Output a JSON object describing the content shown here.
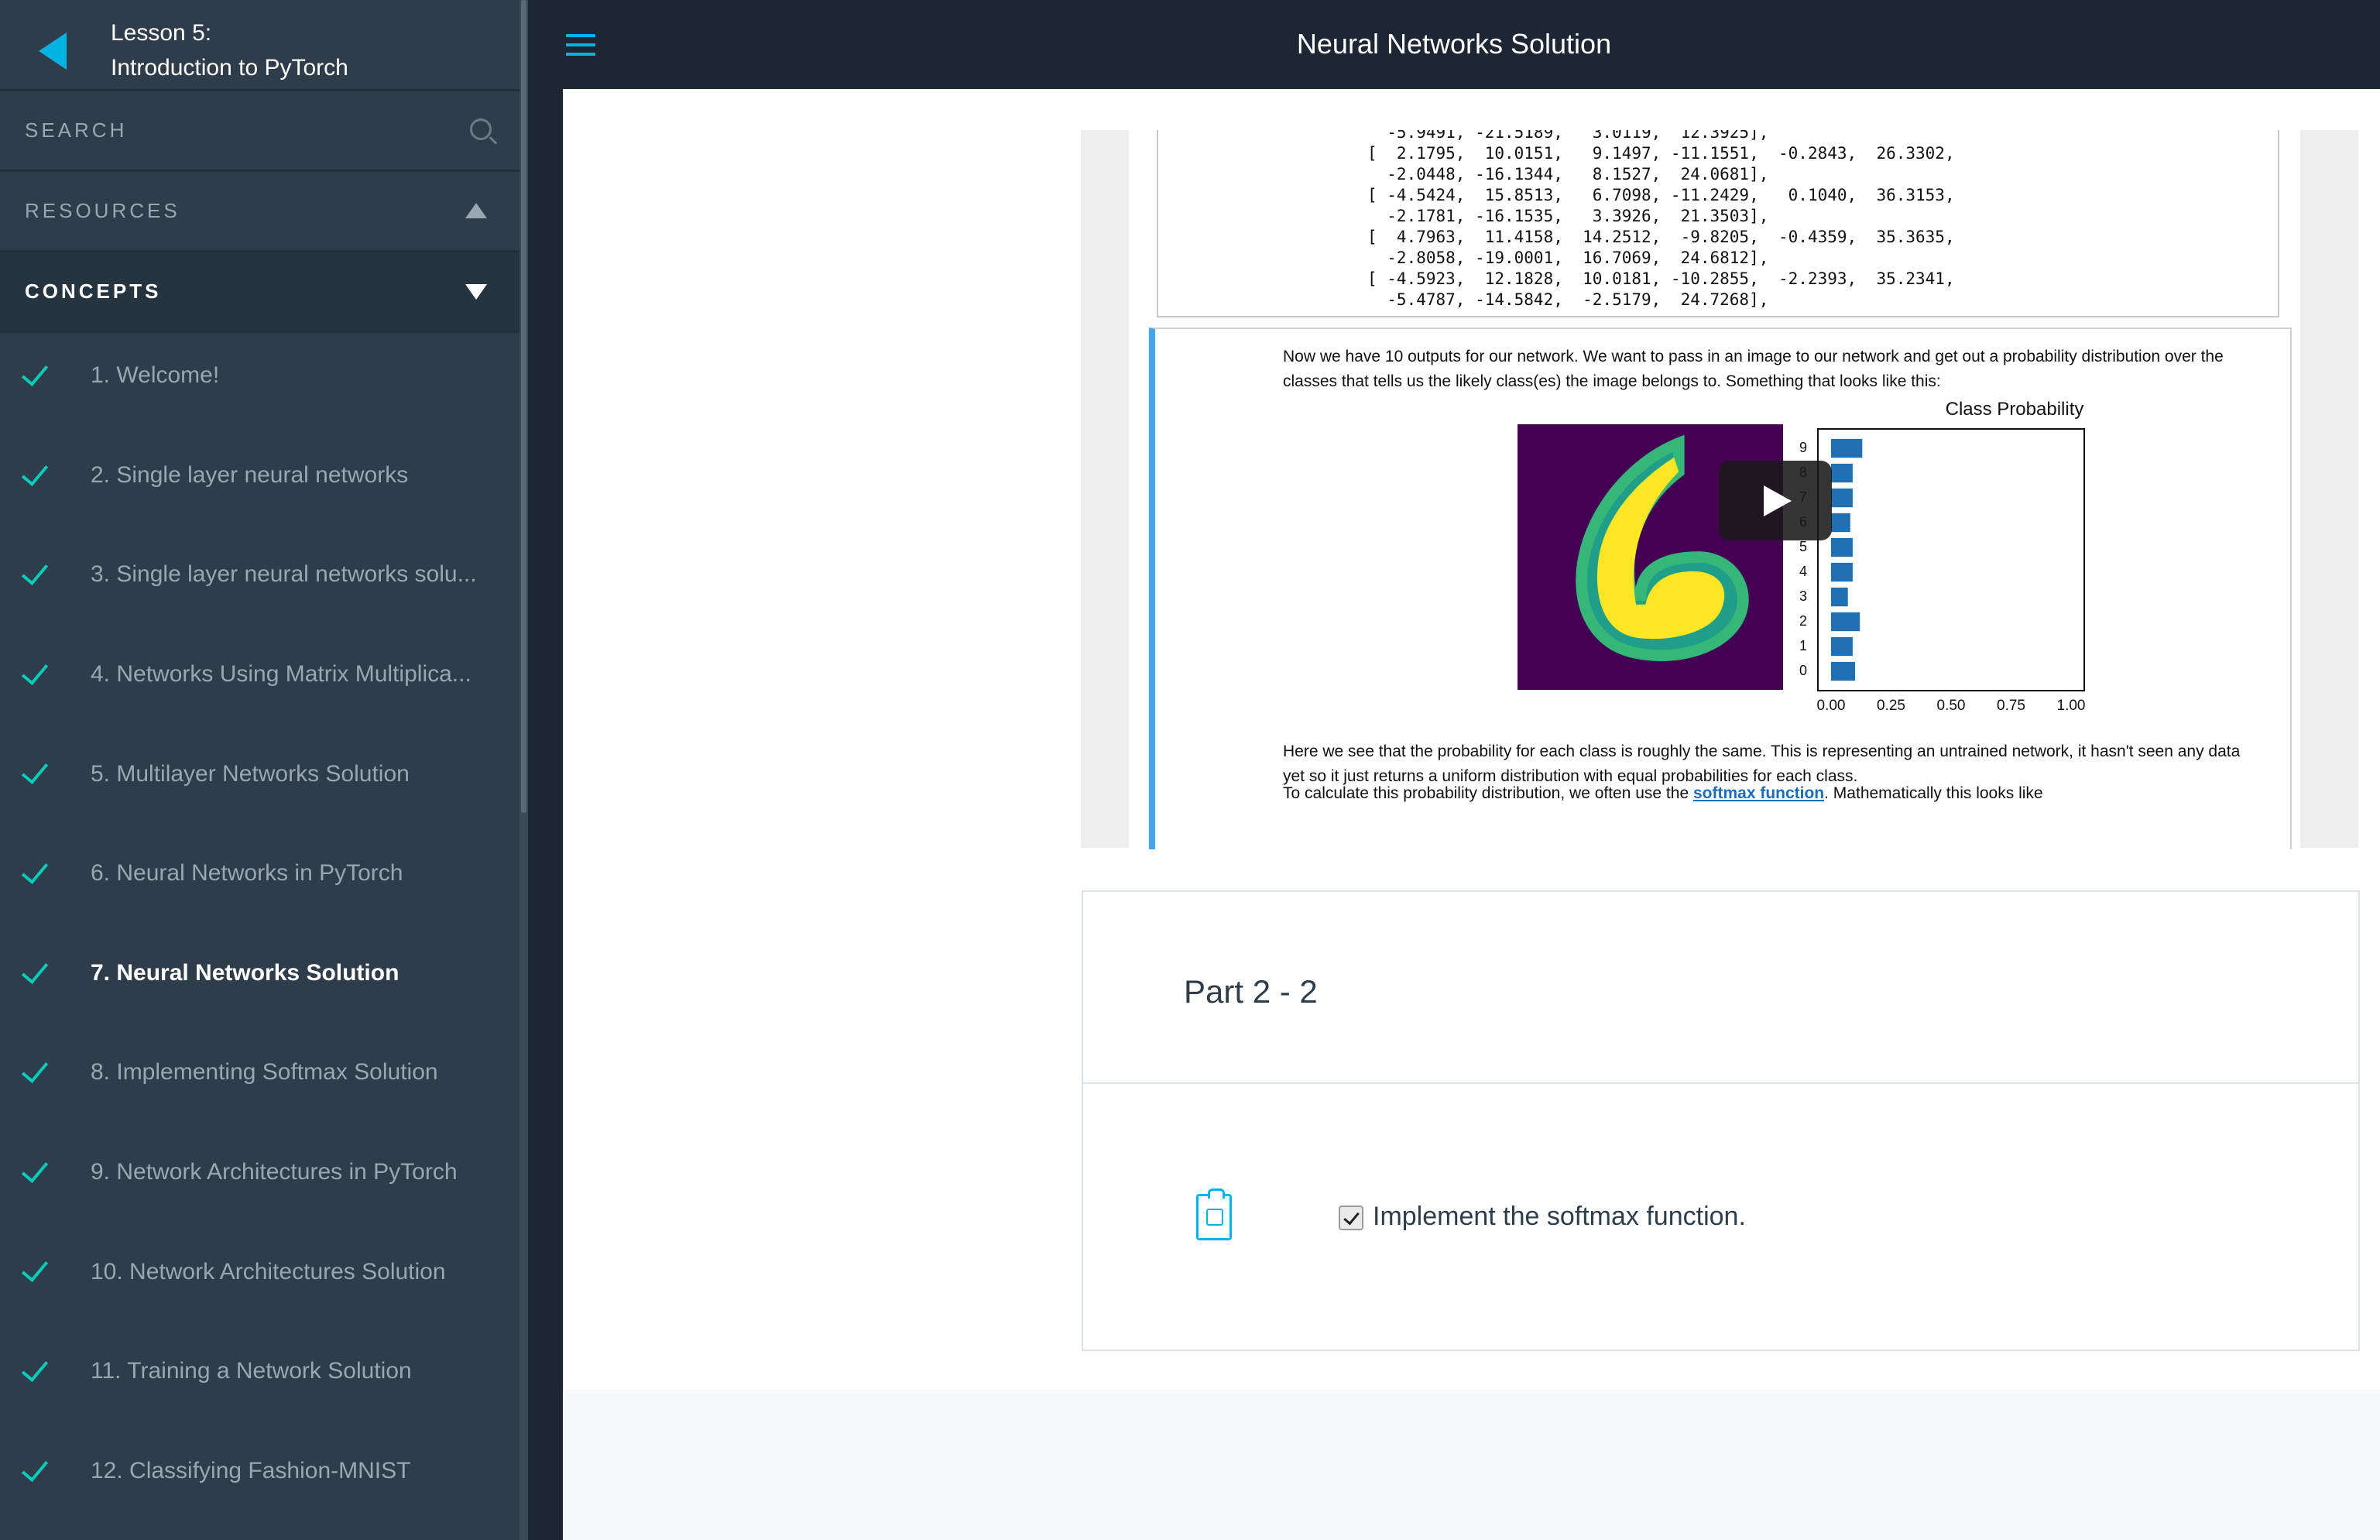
{
  "sidebar": {
    "lesson_line1": "Lesson 5:",
    "lesson_line2": "Introduction to PyTorch",
    "search_label": "SEARCH",
    "resources_label": "RESOURCES",
    "concepts_label": "CONCEPTS",
    "concepts": [
      {
        "label": "1. Welcome!"
      },
      {
        "label": "2. Single layer neural networks"
      },
      {
        "label": "3. Single layer neural networks solu..."
      },
      {
        "label": "4. Networks Using Matrix Multiplica..."
      },
      {
        "label": "5. Multilayer Networks Solution"
      },
      {
        "label": "6. Neural Networks in PyTorch"
      },
      {
        "label": "7. Neural Networks Solution"
      },
      {
        "label": "8. Implementing Softmax Solution"
      },
      {
        "label": "9. Network Architectures in PyTorch"
      },
      {
        "label": "10. Network Architectures Solution"
      },
      {
        "label": "11. Training a Network Solution"
      },
      {
        "label": "12. Classifying Fashion-MNIST"
      }
    ],
    "active_index": 6
  },
  "header": {
    "title": "Neural Networks Solution"
  },
  "notebook": {
    "code_output": "  -5.9491, -21.5189,   3.0119,  12.3925],\n[  2.1795,  10.0151,   9.1497, -11.1551,  -0.2843,  26.3302,\n  -2.0448, -16.1344,   8.1527,  24.0681],\n[ -4.5424,  15.8513,   6.7098, -11.2429,   0.1040,  36.3153,\n  -2.1781, -16.1535,   3.3926,  21.3503],\n[  4.7963,  11.4158,  14.2512,  -9.8205,  -0.4359,  35.3635,\n  -2.8058, -19.0001,  16.7069,  24.6812],\n[ -4.5923,  12.1828,  10.0181, -10.2855,  -2.2393,  35.2341,\n  -5.4787, -14.5842,  -2.5179,  24.7268],",
    "p1": "Now we have 10 outputs for our network. We want to pass in an image to our network and get out a probability distribution over the classes that tells us the likely class(es) the image belongs to. Something that looks like this:",
    "p2": "Here we see that the probability for each class is roughly the same. This is representing an untrained network, it hasn't seen any data yet so it just returns a uniform distribution with equal probabilities for each class.",
    "p3_before": "To calculate this probability distribution, we often use the ",
    "p3_link": "softmax function",
    "p3_after": ". Mathematically this looks like"
  },
  "chart_data": {
    "type": "bar",
    "orientation": "horizontal",
    "title": "Class Probability",
    "categories": [
      "0",
      "1",
      "2",
      "3",
      "4",
      "5",
      "6",
      "7",
      "8",
      "9"
    ],
    "values": [
      0.1,
      0.09,
      0.12,
      0.07,
      0.09,
      0.09,
      0.08,
      0.09,
      0.09,
      0.13
    ],
    "xlim": [
      0,
      1.0
    ],
    "xticks": [
      "0.00",
      "0.25",
      "0.50",
      "0.75",
      "1.00"
    ],
    "bar_color": "#1f6fb2",
    "grid": false
  },
  "part": {
    "title": "Part 2 - 2",
    "task": "Implement the softmax function.",
    "checked": true
  },
  "colors": {
    "accent": "#02b3e4",
    "sidebar_bg": "#2e3d49",
    "topbar_bg": "#1d2733",
    "check": "#15c26b"
  }
}
